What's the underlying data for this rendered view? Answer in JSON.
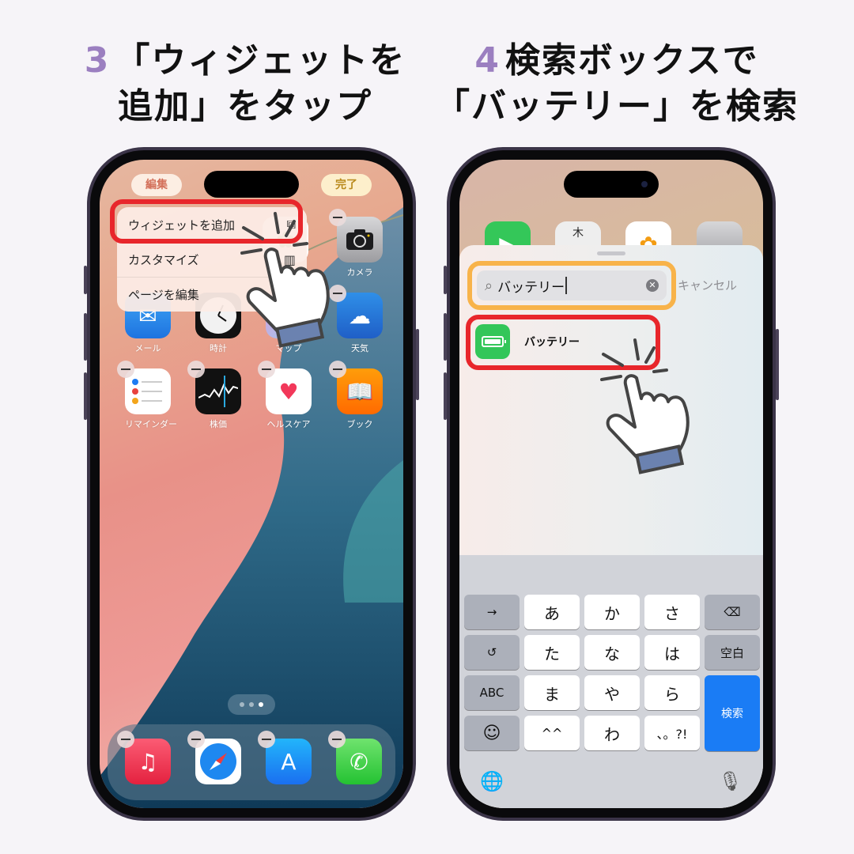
{
  "steps": [
    {
      "number": "3",
      "line1": "「ウィジェットを",
      "line2": "追加」をタップ"
    },
    {
      "number": "4",
      "line1": "検索ボックスで",
      "line2": "「バッテリー」を検索"
    }
  ],
  "colors": {
    "step_number": "#9b7fc0",
    "highlight_red": "#e8262b",
    "highlight_orange": "#f8b34a",
    "keyboard_search": "#1a7cf5",
    "battery_green": "#33c659"
  },
  "phone1": {
    "edit_button": "編集",
    "done_button": "完了",
    "context_menu": [
      {
        "label": "ウィジェットを追加",
        "icon": "add-widget-icon"
      },
      {
        "label": "カスタマイズ",
        "icon": "customize-icon"
      },
      {
        "label": "ページを編集",
        "icon": ""
      }
    ],
    "apps_row1": [
      {
        "label": "",
        "icon": "hidden-app-icon"
      },
      {
        "label": "",
        "icon": "hidden-app-icon"
      },
      {
        "label": "",
        "icon": "photos-icon"
      },
      {
        "label": "カメラ",
        "icon": "camera-icon"
      }
    ],
    "apps_row2": [
      {
        "label": "メール",
        "icon": "mail-icon"
      },
      {
        "label": "時計",
        "icon": "clock-icon"
      },
      {
        "label": "マップ",
        "icon": "maps-icon"
      },
      {
        "label": "天気",
        "icon": "weather-icon"
      }
    ],
    "apps_row3": [
      {
        "label": "リマインダー",
        "icon": "reminders-icon"
      },
      {
        "label": "株価",
        "icon": "stocks-icon"
      },
      {
        "label": "ヘルスケア",
        "icon": "health-icon"
      },
      {
        "label": "ブック",
        "icon": "books-icon"
      }
    ],
    "page_dots": {
      "count": 3,
      "active": 3
    },
    "dock": [
      {
        "name": "music",
        "icon": "music-icon"
      },
      {
        "name": "safari",
        "icon": "safari-icon"
      },
      {
        "name": "app-store",
        "icon": "app-store-icon"
      },
      {
        "name": "phone",
        "icon": "phone-icon"
      }
    ]
  },
  "phone2": {
    "bg_apps": [
      {
        "icon": "facetime-icon"
      },
      {
        "icon": "calendar-icon",
        "text": "木"
      },
      {
        "icon": "photos-icon"
      },
      {
        "icon": "camera-icon"
      }
    ],
    "search": {
      "value": "バッテリー",
      "cancel": "キャンセル"
    },
    "result": {
      "label": "バッテリー"
    },
    "keyboard": {
      "row1": [
        "→",
        "あ",
        "か",
        "さ",
        "⌫"
      ],
      "row2": [
        "↺",
        "た",
        "な",
        "は",
        "空白"
      ],
      "row3": [
        "ABC",
        "ま",
        "や",
        "ら"
      ],
      "row4": [
        "☺",
        "^^",
        "わ",
        "、。?!"
      ],
      "search_key": "検索",
      "globe": "🌐",
      "mic": "🎙"
    }
  }
}
